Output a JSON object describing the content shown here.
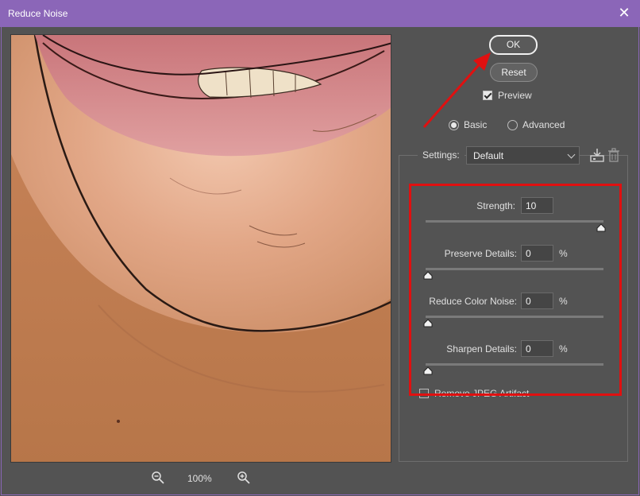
{
  "window": {
    "title": "Reduce Noise",
    "close_glyph": "✕"
  },
  "buttons": {
    "ok_label": "OK",
    "reset_label": "Reset"
  },
  "preview_toggle": {
    "label": "Preview",
    "checked": true
  },
  "mode": {
    "options": [
      "Basic",
      "Advanced"
    ],
    "selected": "Basic"
  },
  "settings": {
    "label": "Settings:",
    "value": "Default",
    "icons": [
      "save-preset-icon",
      "delete-preset-icon"
    ]
  },
  "parameters": [
    {
      "label": "Strength:",
      "value": "10",
      "unit": "",
      "fraction": 1.0
    },
    {
      "label": "Preserve Details:",
      "value": "0",
      "unit": "%",
      "fraction": 0.0
    },
    {
      "label": "Reduce Color Noise:",
      "value": "0",
      "unit": "%",
      "fraction": 0.0
    },
    {
      "label": "Sharpen Details:",
      "value": "0",
      "unit": "%",
      "fraction": 0.0
    }
  ],
  "jpeg_option": {
    "label": "Remove JPEG Artifact",
    "checked": false
  },
  "zoom": {
    "level": "100%",
    "icons": [
      "zoom-out-icon",
      "zoom-in-icon"
    ]
  },
  "annotations": {
    "highlight_color": "#e01010",
    "arrow_color": "#e01010"
  }
}
